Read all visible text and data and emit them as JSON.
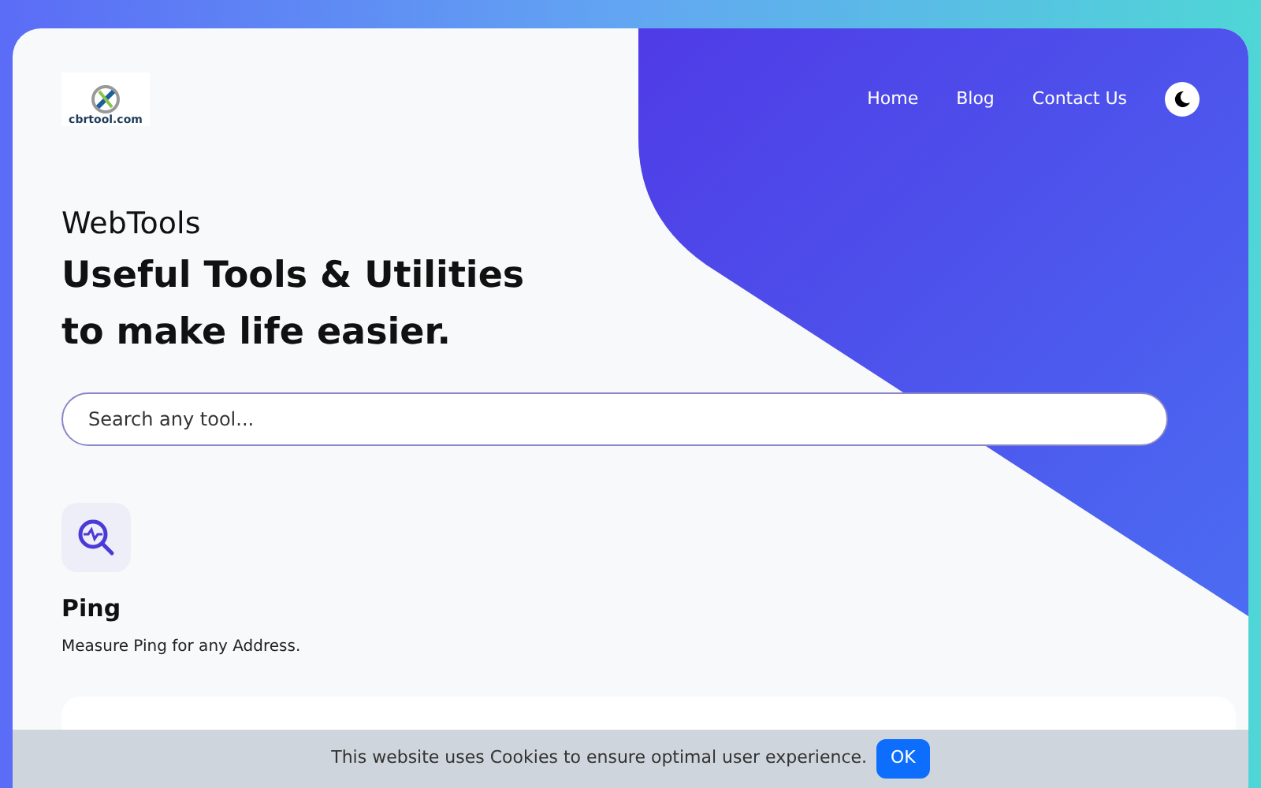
{
  "logo": {
    "text": "cbrtool.com"
  },
  "nav": {
    "links": [
      "Home",
      "Blog",
      "Contact Us"
    ],
    "theme_toggle": {
      "dark": false
    }
  },
  "hero": {
    "brand": "WebTools",
    "headline": [
      "Useful Tools & Utilities",
      "to make life easier."
    ]
  },
  "search": {
    "placeholder": "Search any tool..."
  },
  "tools": [
    {
      "title": "Ping",
      "description": "Measure Ping for any Address."
    }
  ],
  "cookie_bar": {
    "message": "This website uses Cookies to ensure optimal user experience.",
    "button": "OK"
  }
}
